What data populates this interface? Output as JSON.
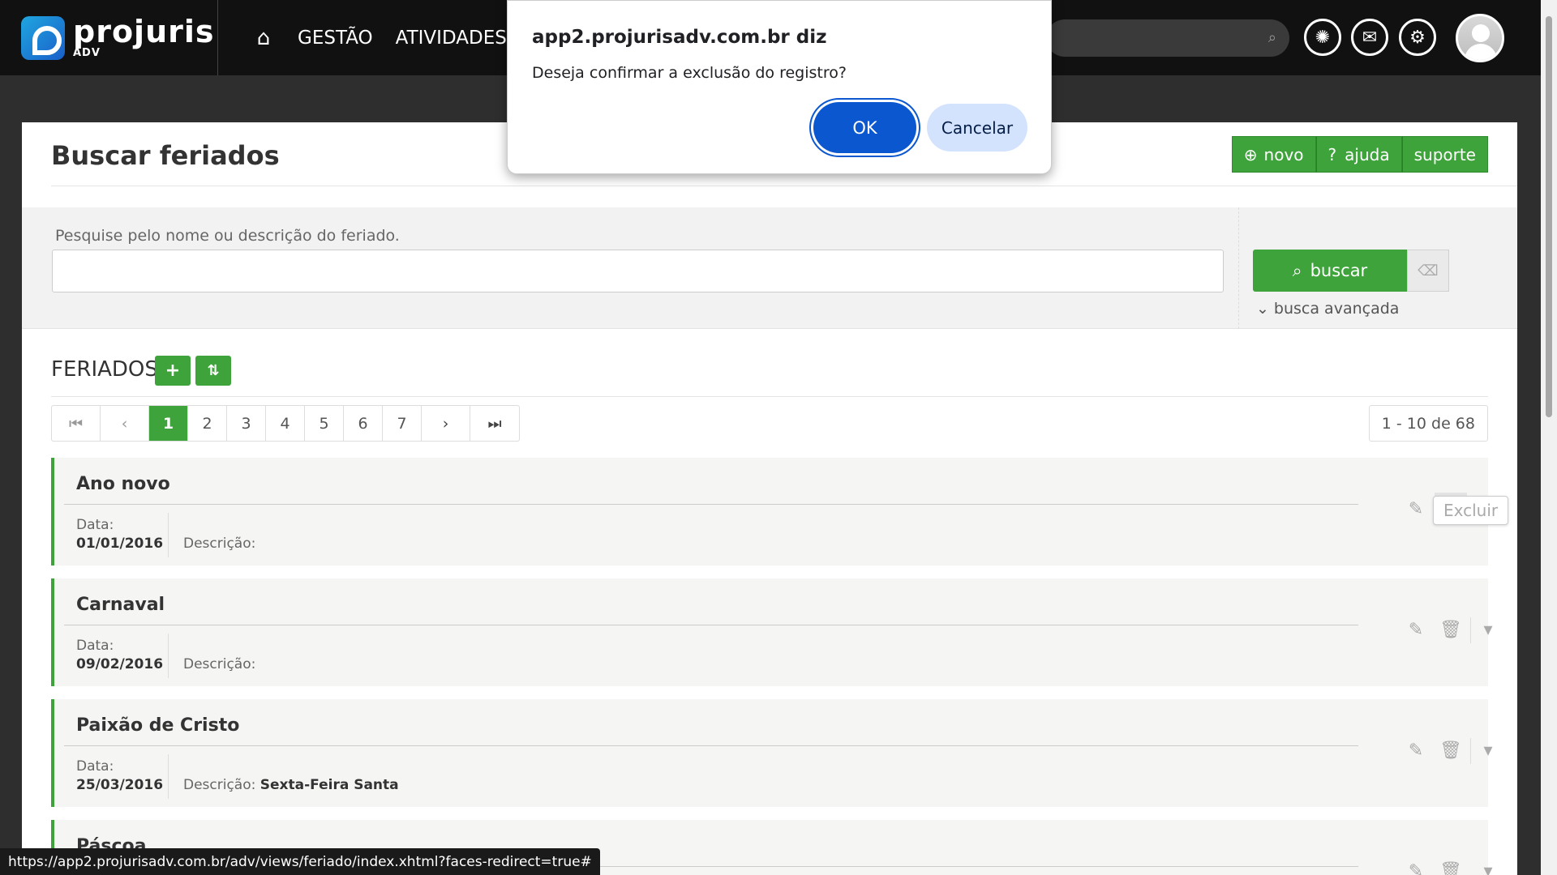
{
  "brand": {
    "name": "projuris",
    "sub": "ADV"
  },
  "nav": {
    "home_icon": "home-icon",
    "items": [
      "GESTÃO",
      "ATIVIDADES"
    ]
  },
  "header_icons": [
    "search-icon",
    "openai-icon",
    "mail-icon",
    "gear-icon",
    "avatar"
  ],
  "page": {
    "title": "Buscar feriados",
    "buttons": {
      "novo": "novo",
      "ajuda": "ajuda",
      "suporte": "suporte"
    }
  },
  "search": {
    "label": "Pesquise pelo nome ou descrição do feriado.",
    "value": "",
    "button": "buscar",
    "advanced": "busca avançada"
  },
  "section": {
    "title": "FERIADOS"
  },
  "pager": {
    "pages": [
      "1",
      "2",
      "3",
      "4",
      "5",
      "6",
      "7"
    ],
    "active": "1",
    "count": "1 - 10 de 68"
  },
  "rows": [
    {
      "name": "Ano novo",
      "date_label": "Data:",
      "date": "01/01/2016",
      "desc_label": "Descrição:",
      "desc": ""
    },
    {
      "name": "Carnaval",
      "date_label": "Data:",
      "date": "09/02/2016",
      "desc_label": "Descrição:",
      "desc": ""
    },
    {
      "name": "Paixão de Cristo",
      "date_label": "Data:",
      "date": "25/03/2016",
      "desc_label": "Descrição:",
      "desc": "Sexta-Feira Santa"
    },
    {
      "name": "Páscoa"
    }
  ],
  "tooltip": "Excluir",
  "status_url": "https://app2.projurisadv.com.br/adv/views/feriado/index.xhtml?faces-redirect=true#",
  "dialog": {
    "title": "app2.projurisadv.com.br diz",
    "message": "Deseja confirmar a exclusão do registro?",
    "ok": "OK",
    "cancel": "Cancelar"
  },
  "colors": {
    "accent": "#3fa33c",
    "dialog_primary": "#0b57d0",
    "dialog_secondary": "#d3e3fd"
  }
}
